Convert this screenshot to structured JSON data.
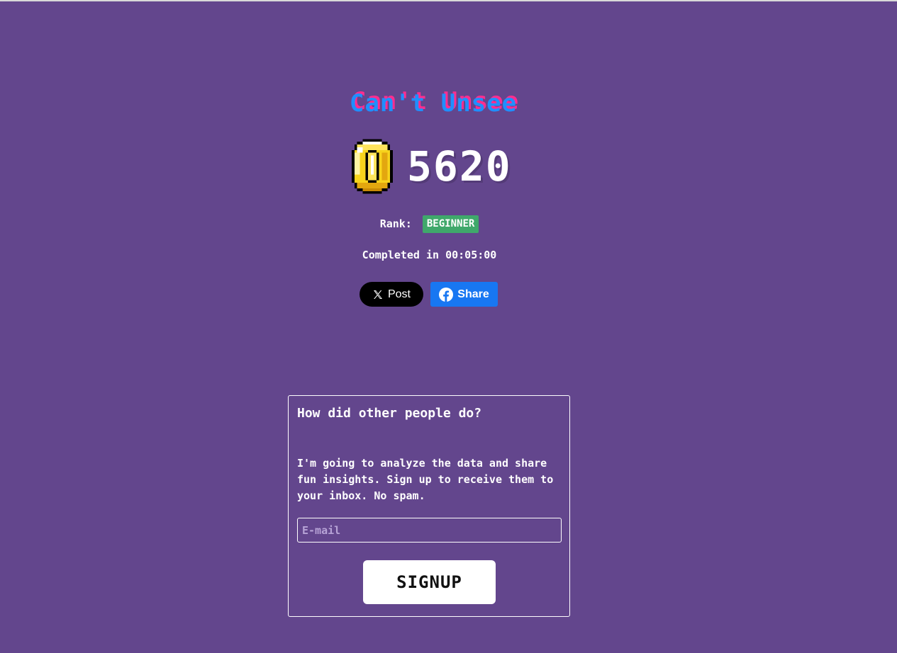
{
  "title": "Can't Unsee",
  "score": {
    "coin_icon": "gold-coin-icon",
    "value": "5620"
  },
  "rank": {
    "label": "Rank:",
    "value": "BEGINNER",
    "badge_color": "#3fa86b"
  },
  "completed": "Completed in 00:05:00",
  "share": {
    "x_post_label": "Post",
    "facebook_label": "Share",
    "x_color": "#000000",
    "facebook_color": "#1877f2"
  },
  "signup_panel": {
    "heading": "How did other people do?",
    "description": "I'm going to analyze the data and share fun insights. Sign up to receive them to your inbox. No spam.",
    "email_placeholder": "E-mail",
    "email_value": "",
    "button_label": "SIGNUP"
  },
  "colors": {
    "background": "#63468d",
    "title_blue": "#1f8fff",
    "title_pink": "#ff2d8f"
  }
}
